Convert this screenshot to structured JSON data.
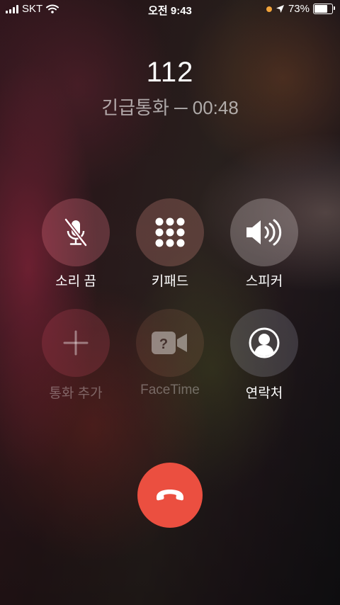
{
  "status_bar": {
    "carrier": "SKT",
    "time": "오전 9:43",
    "battery_percent": "73%",
    "battery_level": 0.73
  },
  "call": {
    "number": "112",
    "status": "긴급통화 ─ 00:48"
  },
  "buttons": {
    "mute": {
      "label": "소리 끔",
      "icon": "mic-slash-icon",
      "enabled": true
    },
    "keypad": {
      "label": "키패드",
      "icon": "keypad-icon",
      "enabled": true
    },
    "speaker": {
      "label": "스피커",
      "icon": "speaker-icon",
      "enabled": true
    },
    "add_call": {
      "label": "통화 추가",
      "icon": "plus-icon",
      "enabled": false
    },
    "facetime": {
      "label": "FaceTime",
      "icon": "facetime-icon",
      "enabled": false
    },
    "contacts": {
      "label": "연락처",
      "icon": "contact-icon",
      "enabled": true
    }
  },
  "end_call": {
    "icon": "phone-down-icon",
    "color": "#eb4f40"
  }
}
